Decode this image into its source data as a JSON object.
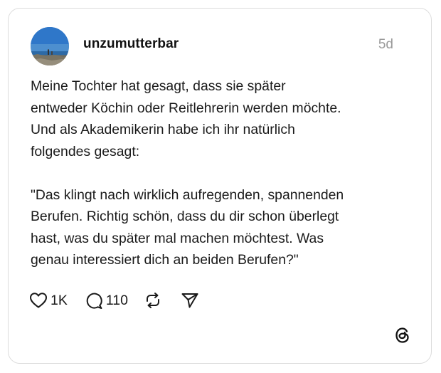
{
  "post": {
    "author": {
      "username": "unzumutterbar"
    },
    "timestamp": "5d",
    "paragraphs": [
      "Meine Tochter hat gesagt, dass sie später\nentweder Köchin oder Reitlehrerin werden möchte.\nUnd als Akademikerin habe ich ihr natürlich\nfolgendes gesagt:",
      "\"Das klingt nach wirklich aufregenden, spannenden\nBerufen. Richtig schön, dass du dir schon überlegt\nhast, was du später mal machen möchtest. Was\ngenau interessiert dich an beiden Berufen?\""
    ],
    "actions": {
      "likes": "1K",
      "replies": "110"
    },
    "icons": {
      "like": "heart-icon",
      "reply": "speech-bubble-icon",
      "repost": "repost-icon",
      "share": "paper-plane-icon",
      "brand": "threads-logo"
    }
  }
}
